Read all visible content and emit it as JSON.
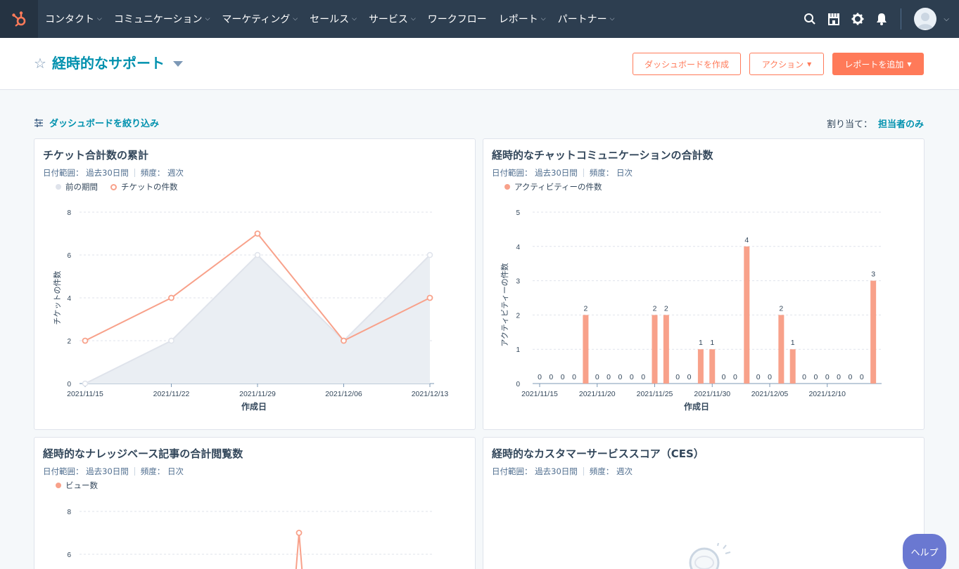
{
  "nav": {
    "items": [
      {
        "label": "コンタクト",
        "has_menu": true
      },
      {
        "label": "コミュニケーション",
        "has_menu": true
      },
      {
        "label": "マーケティング",
        "has_menu": true
      },
      {
        "label": "セールス",
        "has_menu": true
      },
      {
        "label": "サービス",
        "has_menu": true
      },
      {
        "label": "ワークフロー",
        "has_menu": false
      },
      {
        "label": "レポート",
        "has_menu": true
      },
      {
        "label": "パートナー",
        "has_menu": true
      }
    ],
    "icons": [
      "search-icon",
      "marketplace-icon",
      "gear-icon",
      "bell-icon"
    ]
  },
  "header": {
    "title": "経時的なサポート",
    "create_dashboard": "ダッシュボードを作成",
    "actions": "アクション",
    "add_report": "レポートを追加"
  },
  "filter": {
    "label": "ダッシュボードを絞り込み",
    "assign_label": "割り当て：",
    "assign_value": "担当者のみ"
  },
  "help": "ヘルプ",
  "colors": {
    "accent": "#ff7a59",
    "series": "#f8a18a",
    "prev": "#dfe3eb",
    "link": "#0091ae"
  },
  "cards": [
    {
      "title": "チケット合計数の累計",
      "range_label": "日付範囲：",
      "range": "過去30日間",
      "freq_label": "頻度：",
      "freq": "週次",
      "legend": [
        "前の期間",
        "チケットの件数"
      ]
    },
    {
      "title": "経時的なチャットコミュニケーションの合計数",
      "range_label": "日付範囲：",
      "range": "過去30日間",
      "freq_label": "頻度：",
      "freq": "日次",
      "legend": [
        "アクティビティーの件数"
      ]
    },
    {
      "title": "経時的なナレッジベース記事の合計閲覧数",
      "range_label": "日付範囲：",
      "range": "過去30日間",
      "freq_label": "頻度：",
      "freq": "日次",
      "legend": [
        "ビュー数"
      ]
    },
    {
      "title": "経時的なカスタマーサービススコア（CES）",
      "range_label": "日付範囲：",
      "range": "過去30日間",
      "freq_label": "頻度：",
      "freq": "週次",
      "legend": []
    }
  ],
  "chart_data": [
    {
      "type": "line",
      "categories": [
        "2021/11/15",
        "2021/11/22",
        "2021/11/29",
        "2021/12/06",
        "2021/12/13"
      ],
      "series": [
        {
          "name": "前の期間",
          "values": [
            0,
            2,
            6,
            2,
            6
          ],
          "style": "area"
        },
        {
          "name": "チケットの件数",
          "values": [
            2,
            4,
            7,
            2,
            4
          ]
        }
      ],
      "xlabel": "作成日",
      "ylabel": "チケットの件数",
      "yticks": [
        0,
        2,
        4,
        6,
        8
      ],
      "ylim": [
        0,
        8
      ],
      "grid": true
    },
    {
      "type": "bar",
      "categories": [
        "2021/11/15",
        "2021/11/16",
        "2021/11/17",
        "2021/11/18",
        "2021/11/19",
        "2021/11/20",
        "2021/11/21",
        "2021/11/22",
        "2021/11/23",
        "2021/11/24",
        "2021/11/25",
        "2021/11/26",
        "2021/11/27",
        "2021/11/28",
        "2021/11/29",
        "2021/11/30",
        "2021/12/01",
        "2021/12/02",
        "2021/12/03",
        "2021/12/04",
        "2021/12/05",
        "2021/12/06",
        "2021/12/07",
        "2021/12/08",
        "2021/12/09",
        "2021/12/10",
        "2021/12/11",
        "2021/12/12",
        "2021/12/13",
        "2021/12/14"
      ],
      "xtick_labels": [
        "2021/11/15",
        "2021/11/20",
        "2021/11/25",
        "2021/11/30",
        "2021/12/05",
        "2021/12/10"
      ],
      "series": [
        {
          "name": "アクティビティーの件数",
          "values": [
            0,
            0,
            0,
            0,
            2,
            0,
            0,
            0,
            0,
            0,
            2,
            2,
            0,
            0,
            1,
            1,
            0,
            0,
            4,
            0,
            0,
            2,
            1,
            0,
            0,
            0,
            0,
            0,
            0,
            3
          ]
        }
      ],
      "xlabel": "作成日",
      "ylabel": "アクティビティーの件数",
      "yticks": [
        0,
        1,
        2,
        3,
        4,
        5
      ],
      "ylim": [
        0,
        5
      ],
      "grid": true,
      "data_labels": true
    },
    {
      "type": "line",
      "series": [
        {
          "name": "ビュー数",
          "values": [
            7
          ],
          "note_visible_peak": 7
        }
      ],
      "yticks": [
        6,
        8
      ],
      "ylim": [
        0,
        8
      ],
      "grid": true,
      "partially_visible": true
    }
  ]
}
